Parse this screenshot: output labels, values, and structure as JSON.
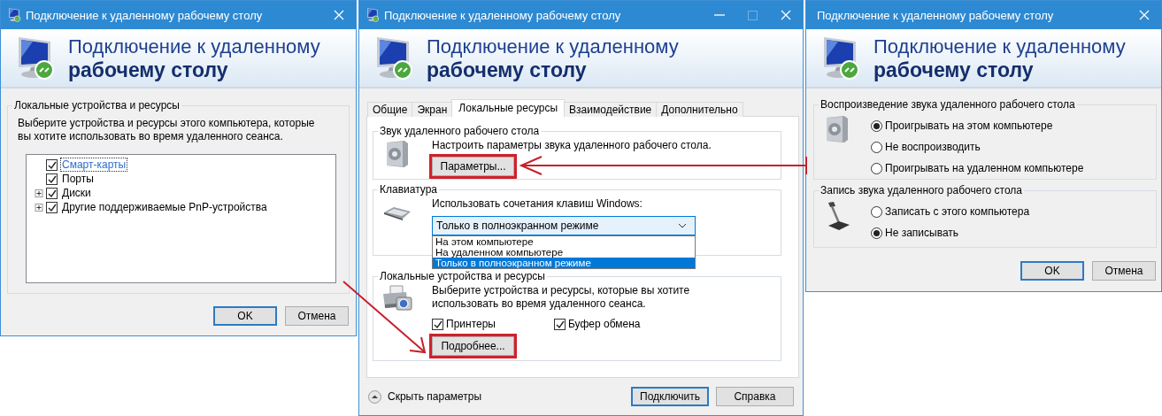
{
  "windows": [
    {
      "kind": "devices",
      "title": "Подключение к удаленному рабочему столу",
      "title_icon": true,
      "title_buttons": [
        {
          "kind": "close",
          "disabled": false
        }
      ],
      "header": {
        "line1": "Подключение к удаленному",
        "line2": "рабочему столу"
      },
      "group": {
        "label": "Локальные устройства и ресурсы",
        "description": "Выберите устройства и ресурсы этого компьютера, которые вы хотите использовать во время удаленного сеанса.",
        "tree": [
          {
            "kind": "leaf",
            "label": "Смарт-карты",
            "checked": true,
            "selected": true
          },
          {
            "kind": "leaf",
            "label": "Порты",
            "checked": true,
            "selected": false
          },
          {
            "kind": "collapsed",
            "label": "Диски",
            "checked": true,
            "selected": false
          },
          {
            "kind": "collapsed",
            "label": "Другие поддерживаемые PnP-устройства",
            "checked": true,
            "selected": false
          }
        ]
      },
      "buttons": [
        {
          "label": "OK",
          "default": true
        },
        {
          "label": "Отмена",
          "default": false
        }
      ]
    },
    {
      "kind": "connection",
      "title": "Подключение к удаленному рабочему столу",
      "title_icon": true,
      "title_buttons": [
        {
          "kind": "minimize",
          "disabled": false
        },
        {
          "kind": "maximize",
          "disabled": true
        },
        {
          "kind": "close",
          "disabled": false
        }
      ],
      "header": {
        "line1": "Подключение к удаленному",
        "line2": "рабочему столу"
      },
      "tabs": [
        {
          "label": "Общие",
          "selected": false
        },
        {
          "label": "Экран",
          "selected": false
        },
        {
          "label": "Локальные ресурсы",
          "selected": true
        },
        {
          "label": "Взаимодействие",
          "selected": false
        },
        {
          "label": "Дополнительно",
          "selected": false
        }
      ],
      "sections": [
        {
          "kind": "sound",
          "label": "Звук удаленного рабочего стола",
          "text": "Настроить параметры звука удаленного рабочего стола.",
          "button": {
            "label": "Параметры...",
            "highlighted": true
          }
        },
        {
          "kind": "keyboard",
          "label": "Клавиатура",
          "text": "Использовать сочетания клавиш Windows:",
          "dropdown": {
            "value": "Только в полноэкранном режиме",
            "expanded": true,
            "options": [
              {
                "label": "На этом компьютере",
                "selected": false
              },
              {
                "label": "На удаленном компьютере",
                "selected": false
              },
              {
                "label": "Только в полноэкранном режиме",
                "selected": true
              }
            ]
          }
        },
        {
          "kind": "devices",
          "label": "Локальные устройства и ресурсы",
          "text": "Выберите устройства и ресурсы, которые вы хотите использовать во время удаленного сеанса.",
          "checkboxes": [
            {
              "label": "Принтеры",
              "checked": true
            },
            {
              "label": "Буфер обмена",
              "checked": true
            }
          ],
          "button": {
            "label": "Подробнее...",
            "highlighted": true
          }
        }
      ],
      "footer": {
        "toggle": {
          "label": "Скрыть параметры",
          "expanded": true
        },
        "buttons": [
          {
            "label": "Подключить",
            "default": true
          },
          {
            "label": "Справка",
            "default": false
          }
        ]
      }
    },
    {
      "kind": "audio",
      "title": "Подключение к удаленному рабочему столу",
      "title_icon": false,
      "title_buttons": [
        {
          "kind": "close",
          "disabled": false
        }
      ],
      "header": {
        "line1": "Подключение к удаленному",
        "line2": "рабочему столу"
      },
      "groups": [
        {
          "kind": "speaker",
          "label": "Воспроизведение звука удаленного рабочего стола",
          "options": [
            {
              "label": "Проигрывать на этом компьютере",
              "selected": true
            },
            {
              "label": "Не воспроизводить",
              "selected": false
            },
            {
              "label": "Проигрывать на удаленном компьютере",
              "selected": false
            }
          ]
        },
        {
          "kind": "microphone",
          "label": "Запись звука удаленного рабочего стола",
          "options": [
            {
              "label": "Записать с этого компьютера",
              "selected": false
            },
            {
              "label": "Не записывать",
              "selected": true
            }
          ]
        }
      ],
      "buttons": [
        {
          "label": "OK",
          "default": true
        },
        {
          "label": "Отмена",
          "default": false
        }
      ]
    }
  ]
}
